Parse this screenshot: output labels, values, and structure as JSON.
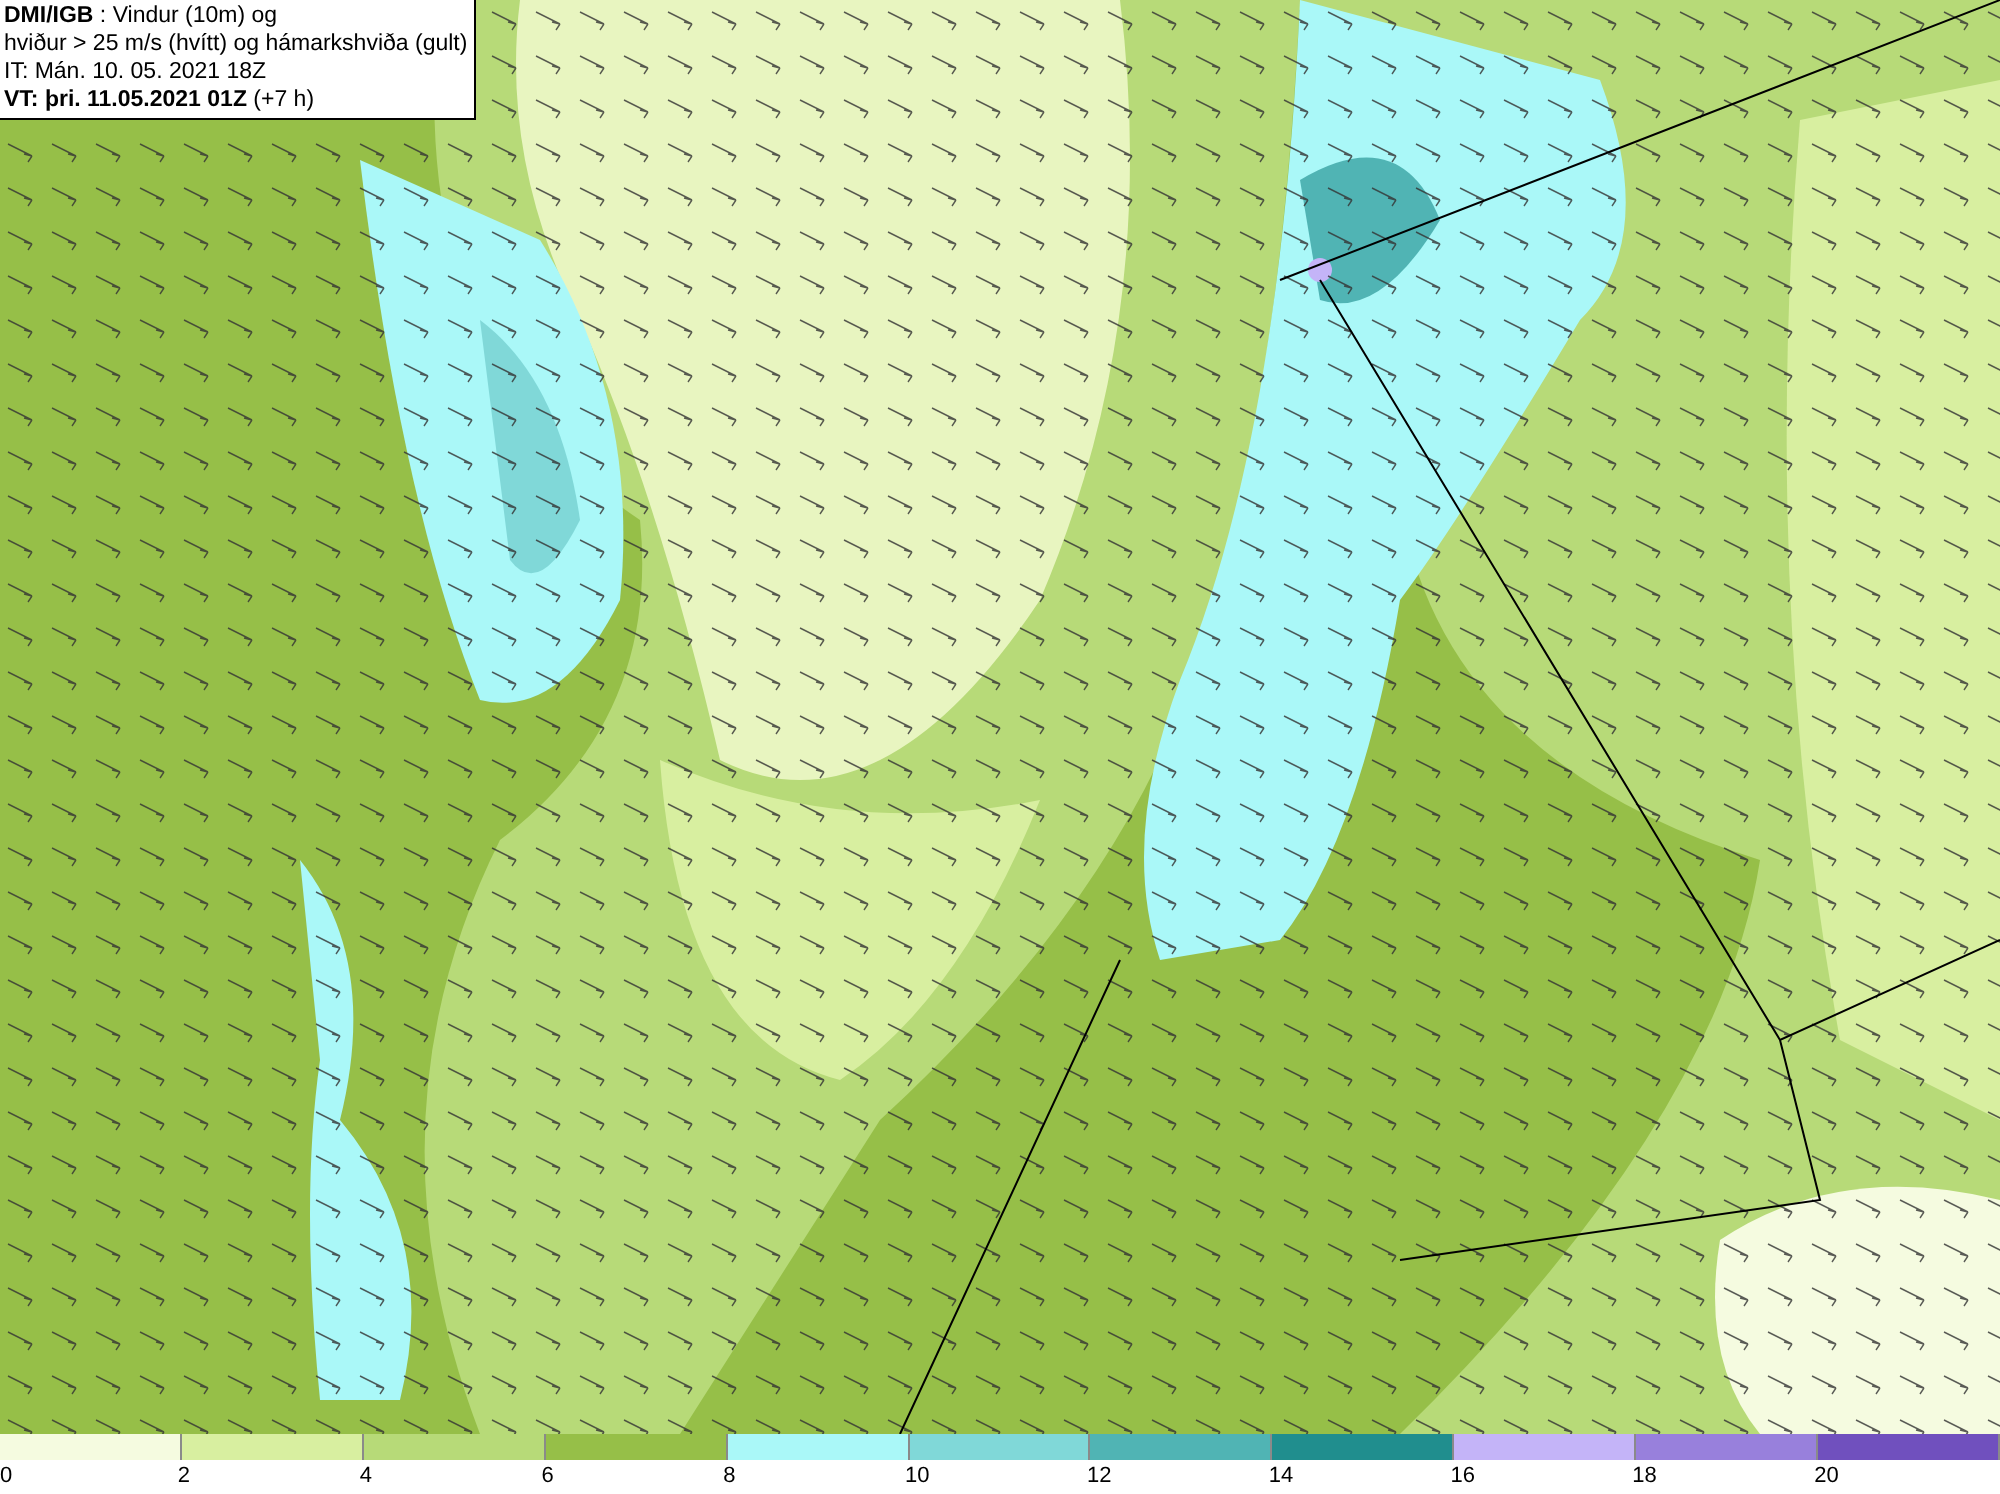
{
  "title_box": {
    "lines": [
      "**DMI/IGB** : Vindur (10m) og",
      "hviður > 25 m/s (hvítt) og hámarkshviða (gult)",
      "IT: Mán. 10. 05. 2021 18Z",
      "**VT: þri. 11.05.2021 01Z** (+7 h)"
    ]
  },
  "legend": {
    "bins": [
      {
        "label": "0",
        "color": "#f5fbe0"
      },
      {
        "label": "2",
        "color": "#d8efa0"
      },
      {
        "label": "4",
        "color": "#b7da78"
      },
      {
        "label": "6",
        "color": "#96bf48"
      },
      {
        "label": "8",
        "color": "#aaf8f8"
      },
      {
        "label": "10",
        "color": "#80d8d8"
      },
      {
        "label": "12",
        "color": "#50b4b4"
      },
      {
        "label": "14",
        "color": "#208e8e"
      },
      {
        "label": "16",
        "color": "#c4b4f8"
      },
      {
        "label": "18",
        "color": "#9880dc"
      },
      {
        "label": "20",
        "color": "#7050be"
      }
    ]
  }
}
